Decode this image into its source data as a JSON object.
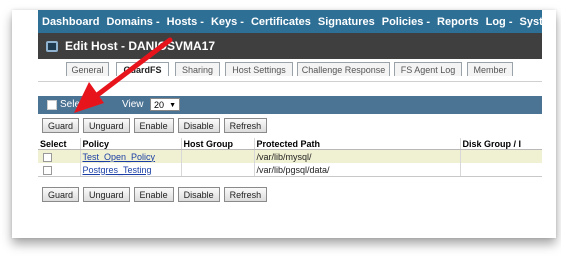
{
  "nav": [
    "Dashboard",
    "Domains -",
    "Hosts -",
    "Keys -",
    "Certificates",
    "Signatures",
    "Policies -",
    "Reports",
    "Log -",
    "System -"
  ],
  "title": "Edit Host - DANIOSVMA17",
  "tabs": [
    "General",
    "GuardFS",
    "Sharing",
    "Host Settings",
    "Challenge Response",
    "FS Agent Log",
    "Member"
  ],
  "active_tab": "GuardFS",
  "viewbar": {
    "select_label": "Sele",
    "view_label": "View",
    "view_value": "20"
  },
  "buttons": {
    "guard": "Guard",
    "unguard": "Unguard",
    "enable": "Enable",
    "disable": "Disable",
    "refresh": "Refresh"
  },
  "table": {
    "headers": [
      "Select",
      "Policy",
      "Host Group",
      "Protected Path",
      "Disk Group / I"
    ],
    "rows": [
      {
        "policy": "Test_Open_Policy",
        "host_group": "",
        "path": "/var/lib/mysql/",
        "disk_group": ""
      },
      {
        "policy": "Postgres_Testing",
        "host_group": "",
        "path": "/var/lib/pgsql/data/",
        "disk_group": ""
      }
    ]
  },
  "colors": {
    "nav_bg": "#2e6f96",
    "titlebar_bg": "#3f3f3f",
    "viewbar_bg": "#4b7394",
    "highlight_row": "#f0f0d2",
    "arrow": "#e8141c"
  }
}
